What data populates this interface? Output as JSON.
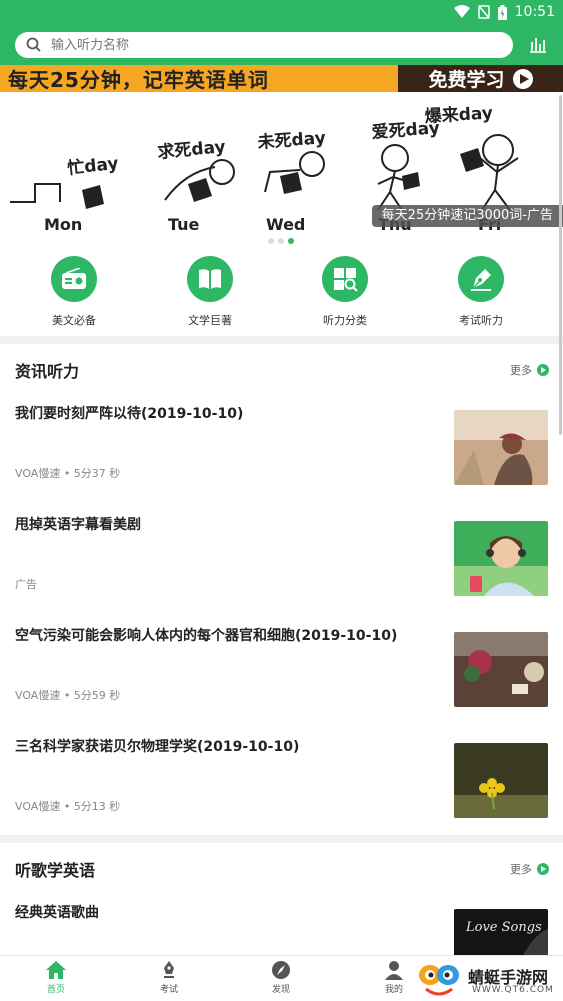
{
  "status": {
    "time": "10:51"
  },
  "search": {
    "placeholder": "输入听力名称"
  },
  "ad_strip": {
    "text": "每天25分钟，记牢英语单词",
    "button": "免费学习"
  },
  "banner": {
    "caption": "每天25分钟速记3000词-广告",
    "days": [
      "Mon",
      "Tue",
      "Wed",
      "Thu",
      "Fri"
    ],
    "moods": [
      "忙day",
      "求死day",
      "未死day",
      "爱死day",
      "爆来day"
    ],
    "dots": 3,
    "active_dot": 2
  },
  "categories": [
    {
      "label": "美文必备",
      "icon": "radio-icon"
    },
    {
      "label": "文学巨著",
      "icon": "book-icon"
    },
    {
      "label": "听力分类",
      "icon": "grid-search-icon"
    },
    {
      "label": "考试听力",
      "icon": "pen-icon"
    }
  ],
  "section1": {
    "title": "资讯听力",
    "more": "更多",
    "items": [
      {
        "title": "我们要时刻严阵以待(2019-10-10)",
        "meta": "VOA慢速 • 5分37 秒"
      },
      {
        "title": "甩掉英语字幕看美剧",
        "meta": "广告"
      },
      {
        "title": "空气污染可能会影响人体内的每个器官和细胞(2019-10-10)",
        "meta": "VOA慢速 • 5分59 秒"
      },
      {
        "title": "三名科学家获诺贝尔物理学奖(2019-10-10)",
        "meta": "VOA慢速 • 5分13 秒"
      }
    ]
  },
  "section2": {
    "title": "听歌学英语",
    "more": "更多",
    "items": [
      {
        "title": "经典英语歌曲",
        "thumb_text": "Love Songs"
      }
    ]
  },
  "tabs": [
    {
      "label": "首页",
      "active": true
    },
    {
      "label": "考试",
      "active": false
    },
    {
      "label": "发现",
      "active": false
    },
    {
      "label": "我的",
      "active": false
    }
  ],
  "watermark": {
    "title": "蜻蜓手游网",
    "url": "WWW.QT6.COM"
  },
  "colors": {
    "primary": "#2eb865",
    "ad_orange": "#f5a623",
    "ad_dark": "#3a2418"
  }
}
